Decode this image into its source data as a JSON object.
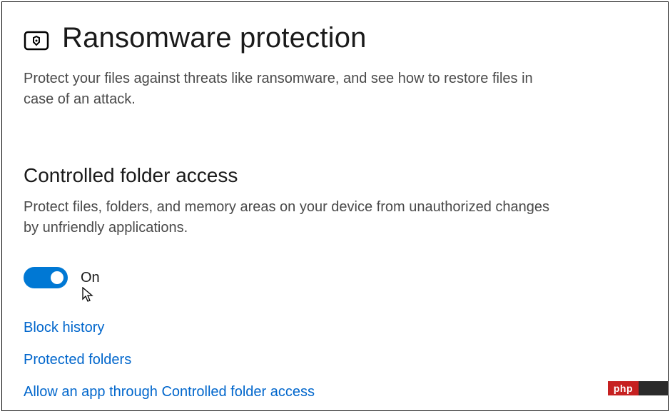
{
  "header": {
    "title": "Ransomware protection",
    "description": "Protect your files against threats like ransomware, and see how to restore files in case of an attack."
  },
  "section": {
    "title": "Controlled folder access",
    "description": "Protect files, folders, and memory areas on your device from unauthorized changes by unfriendly applications."
  },
  "toggle": {
    "state": "On",
    "enabled": true
  },
  "links": {
    "block_history": "Block history",
    "protected_folders": "Protected folders",
    "allow_app": "Allow an app through Controlled folder access"
  },
  "watermark": {
    "left": "php",
    "right": ""
  }
}
